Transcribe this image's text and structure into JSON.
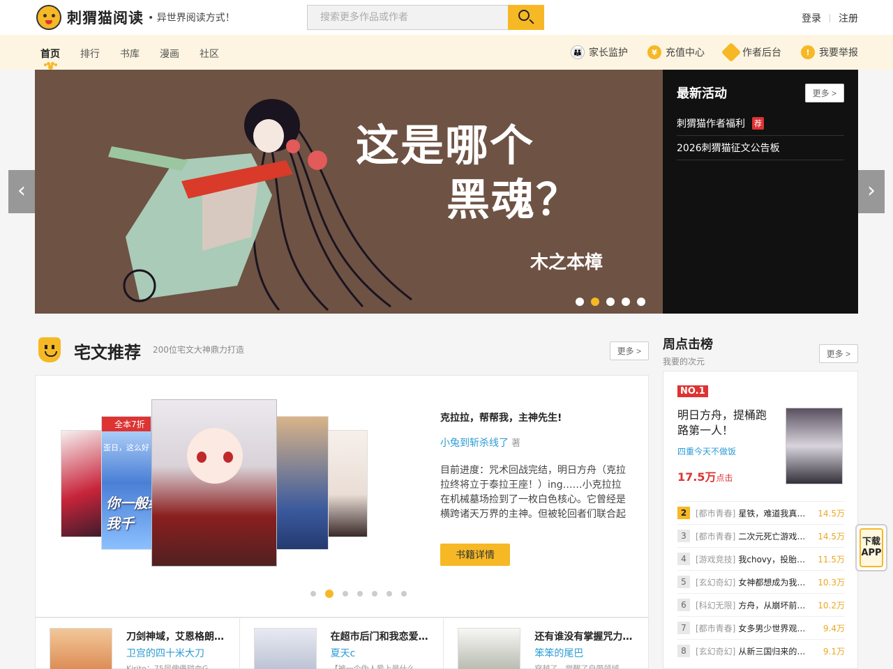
{
  "header": {
    "logo_text": "刺猬猫阅读",
    "slogan": "• 异世界阅读方式！",
    "search_placeholder": "搜索更多作品或作者",
    "login": "登录",
    "register": "注册"
  },
  "nav": {
    "links": [
      "首页",
      "排行",
      "书库",
      "漫画",
      "社区"
    ],
    "tools": [
      "家长监护",
      "充值中心",
      "作者后台",
      "我要举报"
    ]
  },
  "banner": {
    "title_line1": "这是哪个",
    "title_line2": "黑魂？",
    "author_sign": "木之本樟",
    "active_dot": 2
  },
  "activity": {
    "title": "最新活动",
    "more": "更多 >",
    "items": [
      {
        "text": "刺猬猫作者福利",
        "tag": "荐"
      },
      {
        "text": "2026刺猬猫征文公告板",
        "tag": ""
      }
    ]
  },
  "recommend": {
    "title": "宅文推荐",
    "subtitle": "200位宅文大神鼎力打造",
    "more": "更多 >",
    "discount_badge": "全本7折",
    "cover_text": "你一般给我千",
    "cover_text_top": "歪日，这么好",
    "book_title": "克拉拉，帮帮我，主神先生!",
    "author": "小兔到斩杀线了",
    "author_suffix": "著",
    "description": "目前进度：咒术回战完结，明日方舟（克拉拉终将立于泰拉王座！）ing……小克拉拉在机械墓场捡到了一枚白色核心。它曾经是横跨诸天万界的主神。但被轮回者们联合起",
    "detail_button": "书籍详情",
    "active_dot": 1
  },
  "books": [
    {
      "title": "刀剑神域，艾恩格朗…",
      "author": "卫宫的四十米大刀",
      "snippet": "Kirito：75层傀儡铠血G…"
    },
    {
      "title": "在超市后门和我恋爱…",
      "author": "夏天c",
      "snippet": "【被一个伪人爱上是什么"
    },
    {
      "title": "还有谁没有掌握咒力…",
      "author": "笨笨的尾巴",
      "snippet": "穿越了，觉醒了自带领域"
    }
  ],
  "ranking": {
    "title": "周点击榜",
    "subtitle": "我要的次元",
    "more": "更多 >",
    "no1_label": "NO.1",
    "top": {
      "title": "明日方舟，提桶跑路第一人！",
      "author": "四重今天不做饭",
      "clicks": "17.5万",
      "clicks_unit": "点击"
    },
    "rows": [
      {
        "rank": "2",
        "category": "[都市青春]",
        "name": "星铁，难道我真…",
        "count": "14.5万"
      },
      {
        "rank": "3",
        "category": "[都市青春]",
        "name": "二次元死亡游戏…",
        "count": "14.5万"
      },
      {
        "rank": "4",
        "category": "[游戏竞技]",
        "name": "我chovy，投胎…",
        "count": "11.5万"
      },
      {
        "rank": "5",
        "category": "[玄幻奇幻]",
        "name": "女神都想成为我…",
        "count": "10.3万"
      },
      {
        "rank": "6",
        "category": "[科幻无限]",
        "name": "方舟，从崩坏前…",
        "count": "10.2万"
      },
      {
        "rank": "7",
        "category": "[都市青春]",
        "name": "女多男少世界观…",
        "count": "9.4万"
      },
      {
        "rank": "8",
        "category": "[玄幻奇幻]",
        "name": "从新三国归来的…",
        "count": "9.1万"
      }
    ]
  },
  "app_download": {
    "line1": "下载",
    "line2": "APP"
  },
  "colors": {
    "accent": "#f6b825",
    "link": "#2a9bd6",
    "hot": "#dd3333"
  }
}
